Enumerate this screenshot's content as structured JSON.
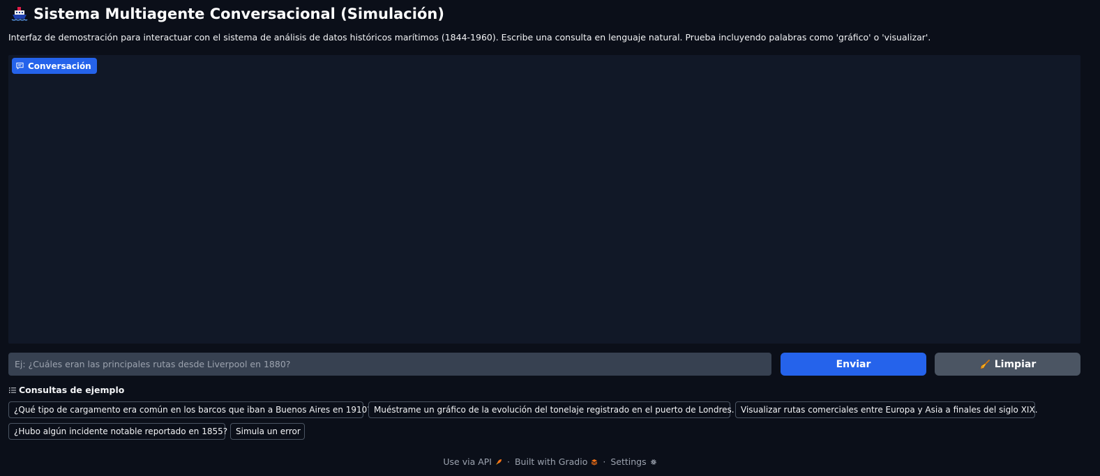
{
  "app": {
    "title": "Sistema Multiagente Conversacional (Simulación)",
    "description": "Interfaz de demostración para interactuar con el sistema de análisis de datos históricos marítimos (1844-1960). Escribe una consulta en lenguaje natural. Prueba incluyendo palabras como 'gráfico' o 'visualizar'."
  },
  "chat": {
    "label": "Conversación",
    "icon": "chat-bubble-icon"
  },
  "query": {
    "value": "",
    "placeholder": "Ej: ¿Cuáles eran las principales rutas desde Liverpool en 1880?"
  },
  "buttons": {
    "send_label": "Enviar",
    "clear_label": "Limpiar",
    "clear_icon": "broom-icon"
  },
  "examples": {
    "header": "Consultas de ejemplo",
    "items": [
      "¿Qué tipo de cargamento era común en los barcos que iban a Buenos Aires en 1910?",
      "Muéstrame un gráfico de la evolución del tonelaje registrado en el puerto de Londres.",
      "Visualizar rutas comerciales entre Europa y Asia a finales del siglo XIX.",
      "¿Hubo algún incidente notable reportado en 1855?",
      "Simula un error"
    ]
  },
  "footer": {
    "api_label": "Use via API",
    "built_label": "Built with Gradio",
    "settings_label": "Settings",
    "separator": "·"
  },
  "colors": {
    "background": "#0b0f19",
    "panel": "#111827",
    "accent": "#2563eb",
    "secondary_button": "#4b5563"
  }
}
